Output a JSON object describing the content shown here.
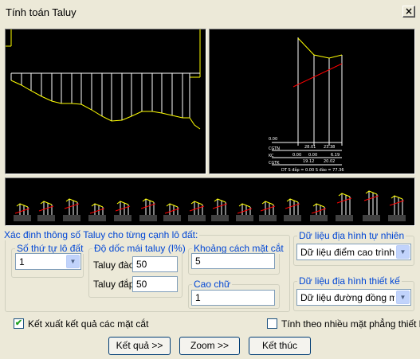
{
  "window": {
    "title": "Tính toán Taluy",
    "close_glyph": "×"
  },
  "canvas": {
    "background": "#000000",
    "profile_color": "#ffff00",
    "line_color": "#ffffff",
    "accent_color": "#ff0000",
    "table": {
      "row1_label": "CGTN",
      "row1_values": [
        "28.01",
        "23.38"
      ],
      "row2_label": "KC",
      "row2_values": [
        "0.00",
        "0.00",
        "6.19"
      ],
      "row3_label": "CGTK",
      "row3_values": [
        "19.12",
        "20.02"
      ],
      "footer": "DT  S đắp = 0.00    S đào = 77.36",
      "datum": "0.00"
    }
  },
  "form": {
    "main_group_title": "Xác định thông số Taluy cho từng cạnh lô đất:",
    "lot_group": {
      "title": "Số thứ tự lô đất",
      "selected": "1"
    },
    "slope_group": {
      "title": "Độ dốc mái taluy (I%)",
      "cut_label": "Taluy đào",
      "cut_value": "50",
      "fill_label": "Taluy đắp",
      "fill_value": "50"
    },
    "distance_group": {
      "title": "Khoảng cách mặt cắt",
      "value": "5"
    },
    "text_height_group": {
      "title": "Cao chữ",
      "value": "1"
    },
    "natural_terrain_group": {
      "title": "Dữ liệu địa hình tự nhiên",
      "selected": "Dữ liệu điểm cao trình"
    },
    "design_terrain_group": {
      "title": "Dữ liệu địa hình thiết kế",
      "selected": "Dữ liệu đường đồng mức"
    }
  },
  "options": {
    "export_label": "Kết xuất kết quả các mặt cắt",
    "export_checked": true,
    "multi_plane_label": "Tính theo nhiều mặt phẳng thiết kế",
    "multi_plane_checked": false
  },
  "buttons": {
    "results": "Kết quả >>",
    "zoom": "Zoom >>",
    "finish": "Kết thúc"
  }
}
